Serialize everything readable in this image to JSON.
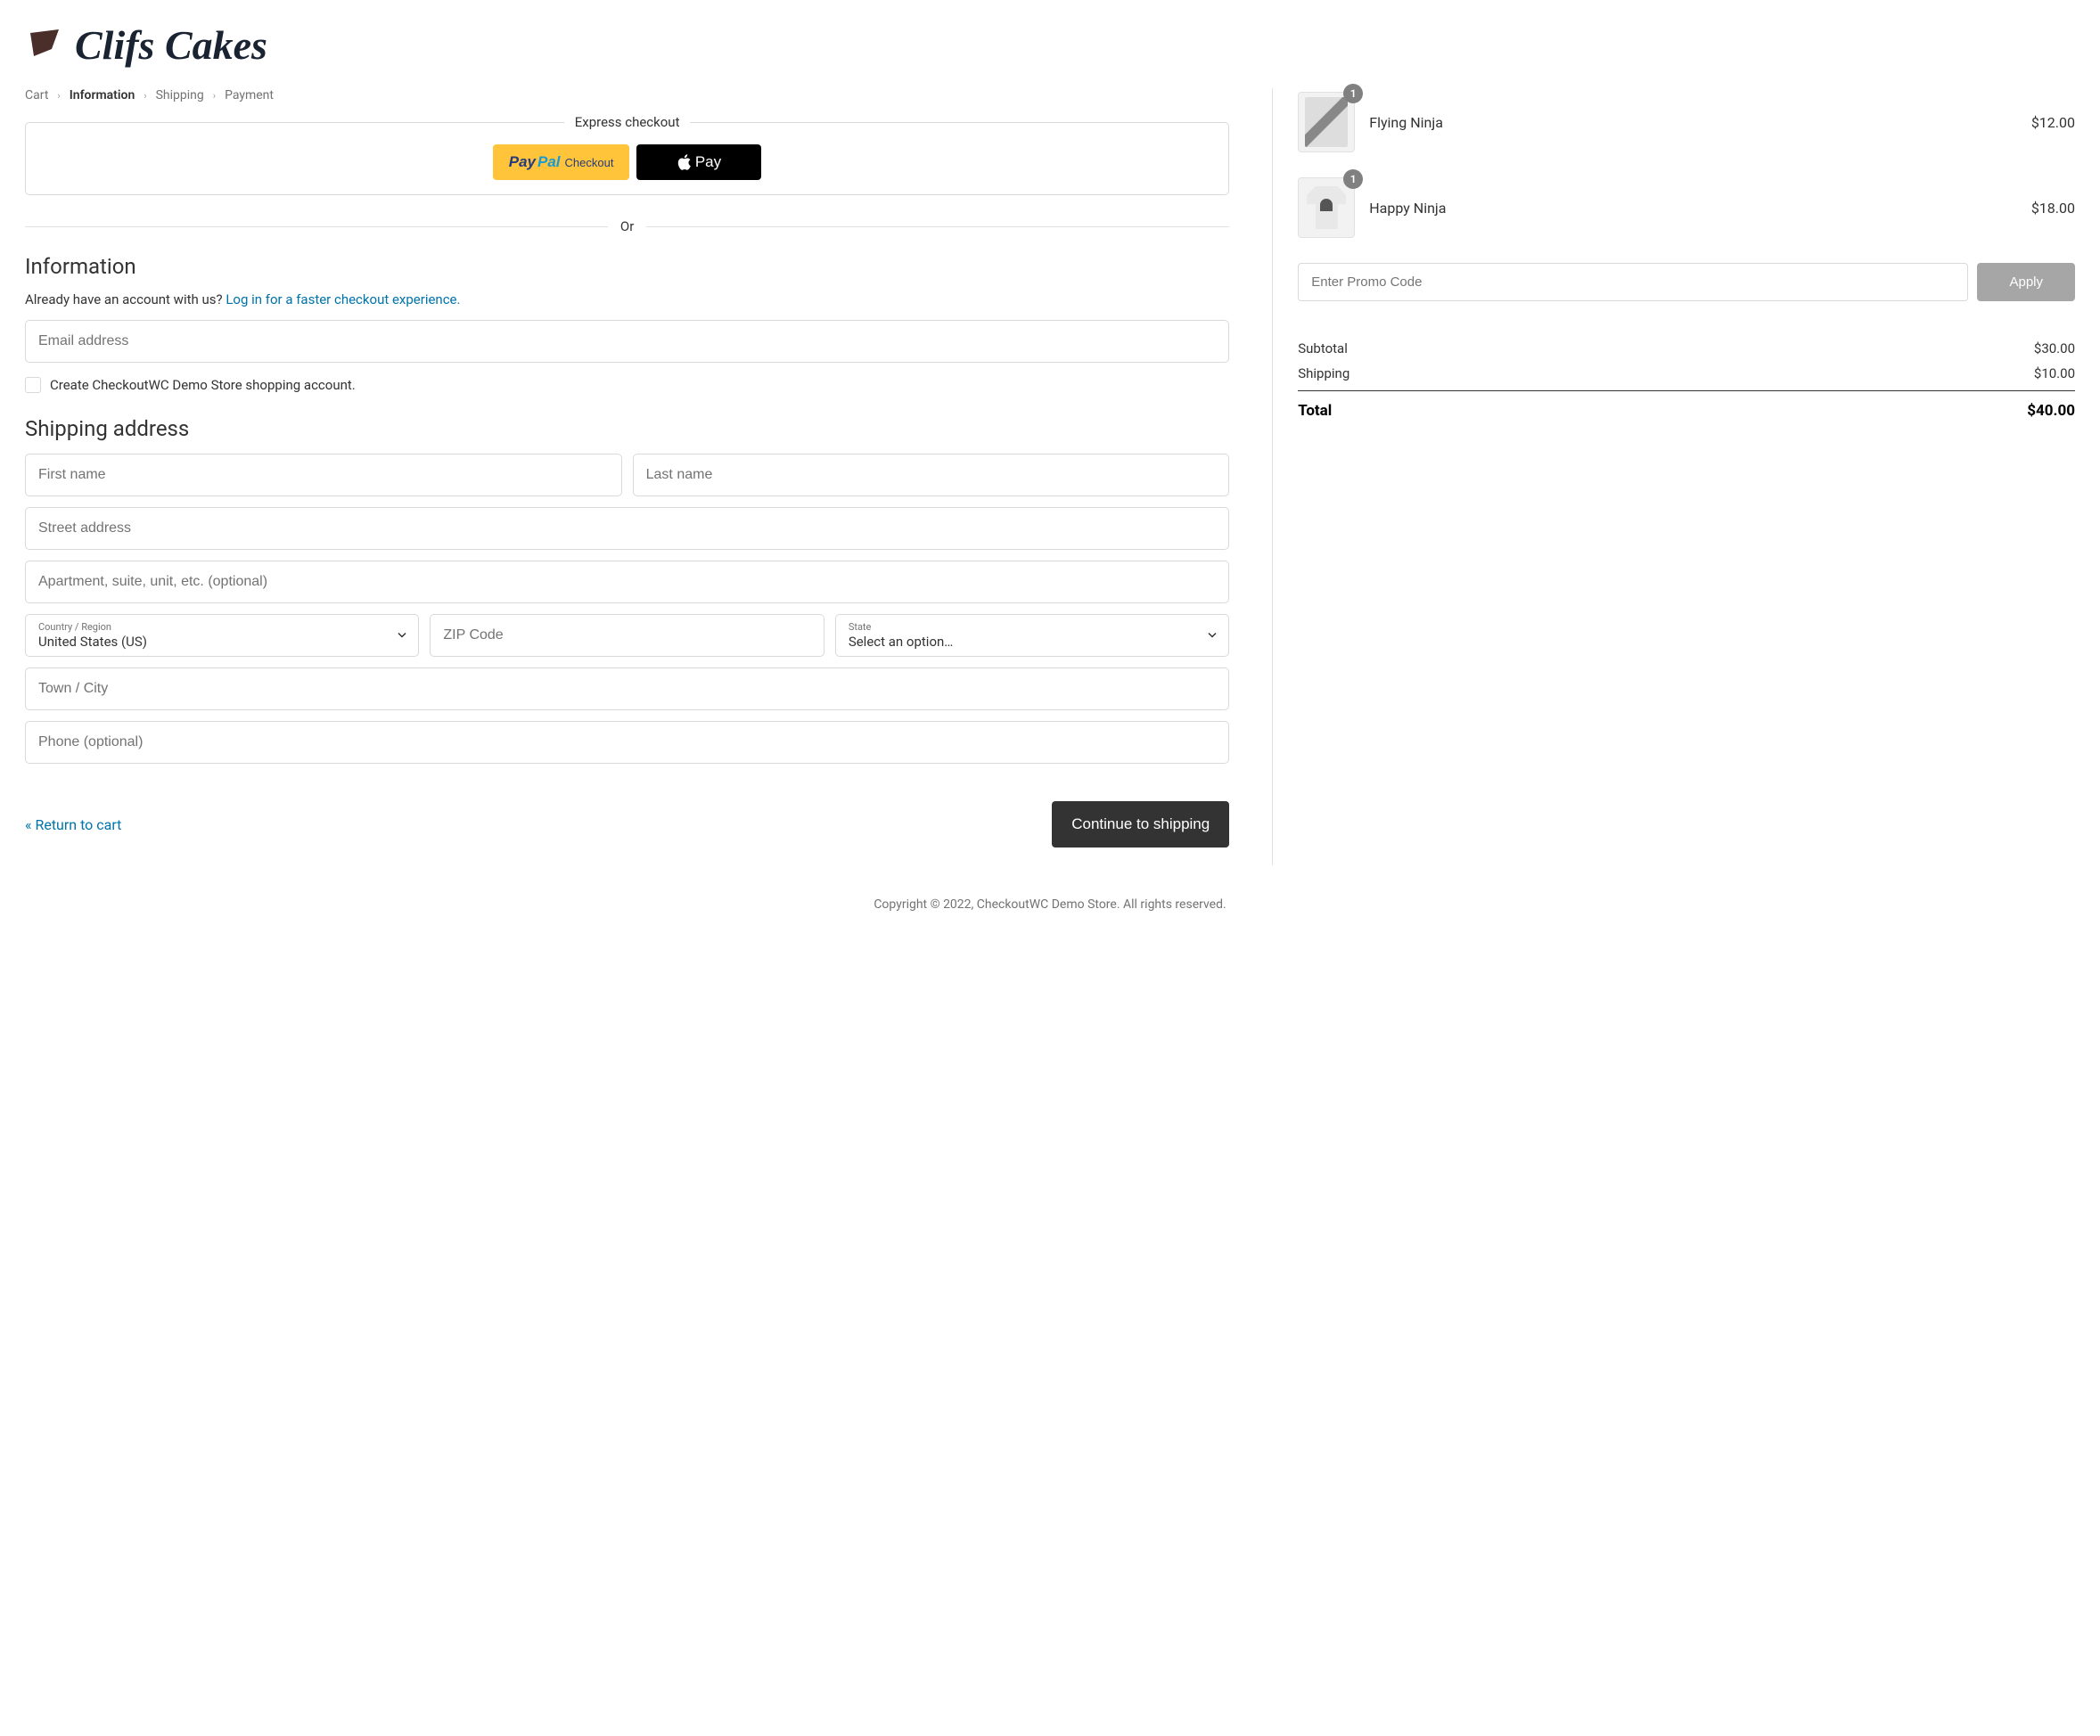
{
  "logo_text": "Clifs Cakes",
  "breadcrumb": {
    "cart": "Cart",
    "information": "Information",
    "shipping": "Shipping",
    "payment": "Payment"
  },
  "express": {
    "label": "Express checkout",
    "paypal_pay": "Pay",
    "paypal_pal": "Pal",
    "paypal_checkout": "Checkout",
    "applepay": "Pay"
  },
  "or": "Or",
  "info": {
    "title": "Information",
    "already_text": "Already have an account with us? ",
    "login_link": "Log in for a faster checkout experience.",
    "email_placeholder": "Email address",
    "checkbox_label": "Create CheckoutWC Demo Store shopping account."
  },
  "ship": {
    "title": "Shipping address",
    "first_ph": "First name",
    "last_ph": "Last name",
    "street_ph": "Street address",
    "apt_ph": "Apartment, suite, unit, etc. (optional)",
    "country_label": "Country / Region",
    "country_value": "United States (US)",
    "zip_ph": "ZIP Code",
    "state_label": "State",
    "state_value": "Select an option…",
    "city_ph": "Town / City",
    "phone_ph": "Phone (optional)"
  },
  "nav": {
    "return": "« Return to cart",
    "continue": "Continue to shipping"
  },
  "cart": {
    "items": [
      {
        "name": "Flying Ninja",
        "qty": "1",
        "price": "$12.00"
      },
      {
        "name": "Happy Ninja",
        "qty": "1",
        "price": "$18.00"
      }
    ],
    "promo_ph": "Enter Promo Code",
    "apply": "Apply",
    "subtotal_label": "Subtotal",
    "subtotal": "$30.00",
    "shipping_label": "Shipping",
    "shipping": "$10.00",
    "total_label": "Total",
    "total": "$40.00"
  },
  "footer": "Copyright © 2022, CheckoutWC Demo Store. All rights reserved."
}
